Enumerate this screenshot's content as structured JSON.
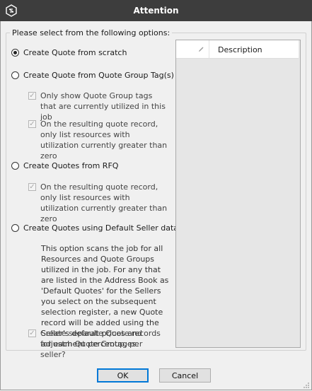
{
  "window": {
    "title": "Attention"
  },
  "group": {
    "legend": "Please select from the following options:"
  },
  "options": [
    {
      "label": "Create Quote from scratch",
      "checked": true
    },
    {
      "label": "Create Quote from Quote Group Tag(s)",
      "checked": false
    },
    {
      "label": "Create Quotes from RFQ",
      "checked": false
    },
    {
      "label": "Create Quotes using Default Seller data",
      "checked": false
    }
  ],
  "sub_checks": {
    "only_show_tags": "Only show Quote Group tags that are currently utilized in this job",
    "tag_only_list_resources": "On the resulting quote record, only list resources with utilization currently greater than zero",
    "rfq_only_list_resources": "On the resulting quote record, only list resources with utilization currently greater than zero",
    "separate_quote_records": "Create separate Quote records for each Quote Group, per seller?"
  },
  "note": "This option scans the job for all Resources and Quote Groups utilized in the job. For any that are listed in the Address Book as 'Default Quotes' for the Sellers you select on the subsequent selection register, a new Quote record will be added using the Seller's default prices and adjustment percentages.",
  "grid": {
    "column_description": "Description"
  },
  "buttons": {
    "ok": "OK",
    "cancel": "Cancel"
  }
}
